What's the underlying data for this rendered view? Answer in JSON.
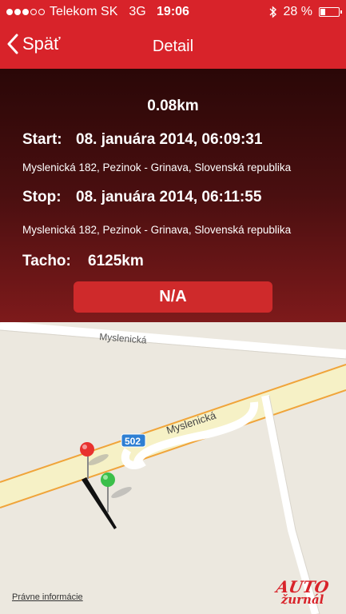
{
  "status": {
    "carrier": "Telekom SK",
    "network": "3G",
    "time": "19:06",
    "battery_text": "28 %",
    "battery_level": 0.28,
    "signal_bars": 3,
    "signal_total": 5
  },
  "nav": {
    "back_label": "Späť",
    "title": "Detail"
  },
  "detail": {
    "distance": "0.08km",
    "start_label": "Start:",
    "start_value": "08. januára 2014, 06:09:31",
    "start_address": "Myslenická 182, Pezinok - Grinava, Slovenská republika",
    "stop_label": "Stop:",
    "stop_value": "08. januára 2014, 06:11:55",
    "stop_address": "Myslenická 182, Pezinok - Grinava, Slovenská republika",
    "tacho_label": "Tacho:",
    "tacho_value": "6125km",
    "na_button": "N/A"
  },
  "map": {
    "street_top": "Myslenická",
    "street_main": "Myslenická",
    "road_badge": "502",
    "legal": "Právne informácie",
    "logo_line1": "AUTO",
    "logo_line2": "žurnál"
  },
  "colors": {
    "brand_red": "#d8232a",
    "pin_start": "#e8322f",
    "pin_end": "#3bbf4a",
    "road_badge": "#2e7fd3"
  }
}
